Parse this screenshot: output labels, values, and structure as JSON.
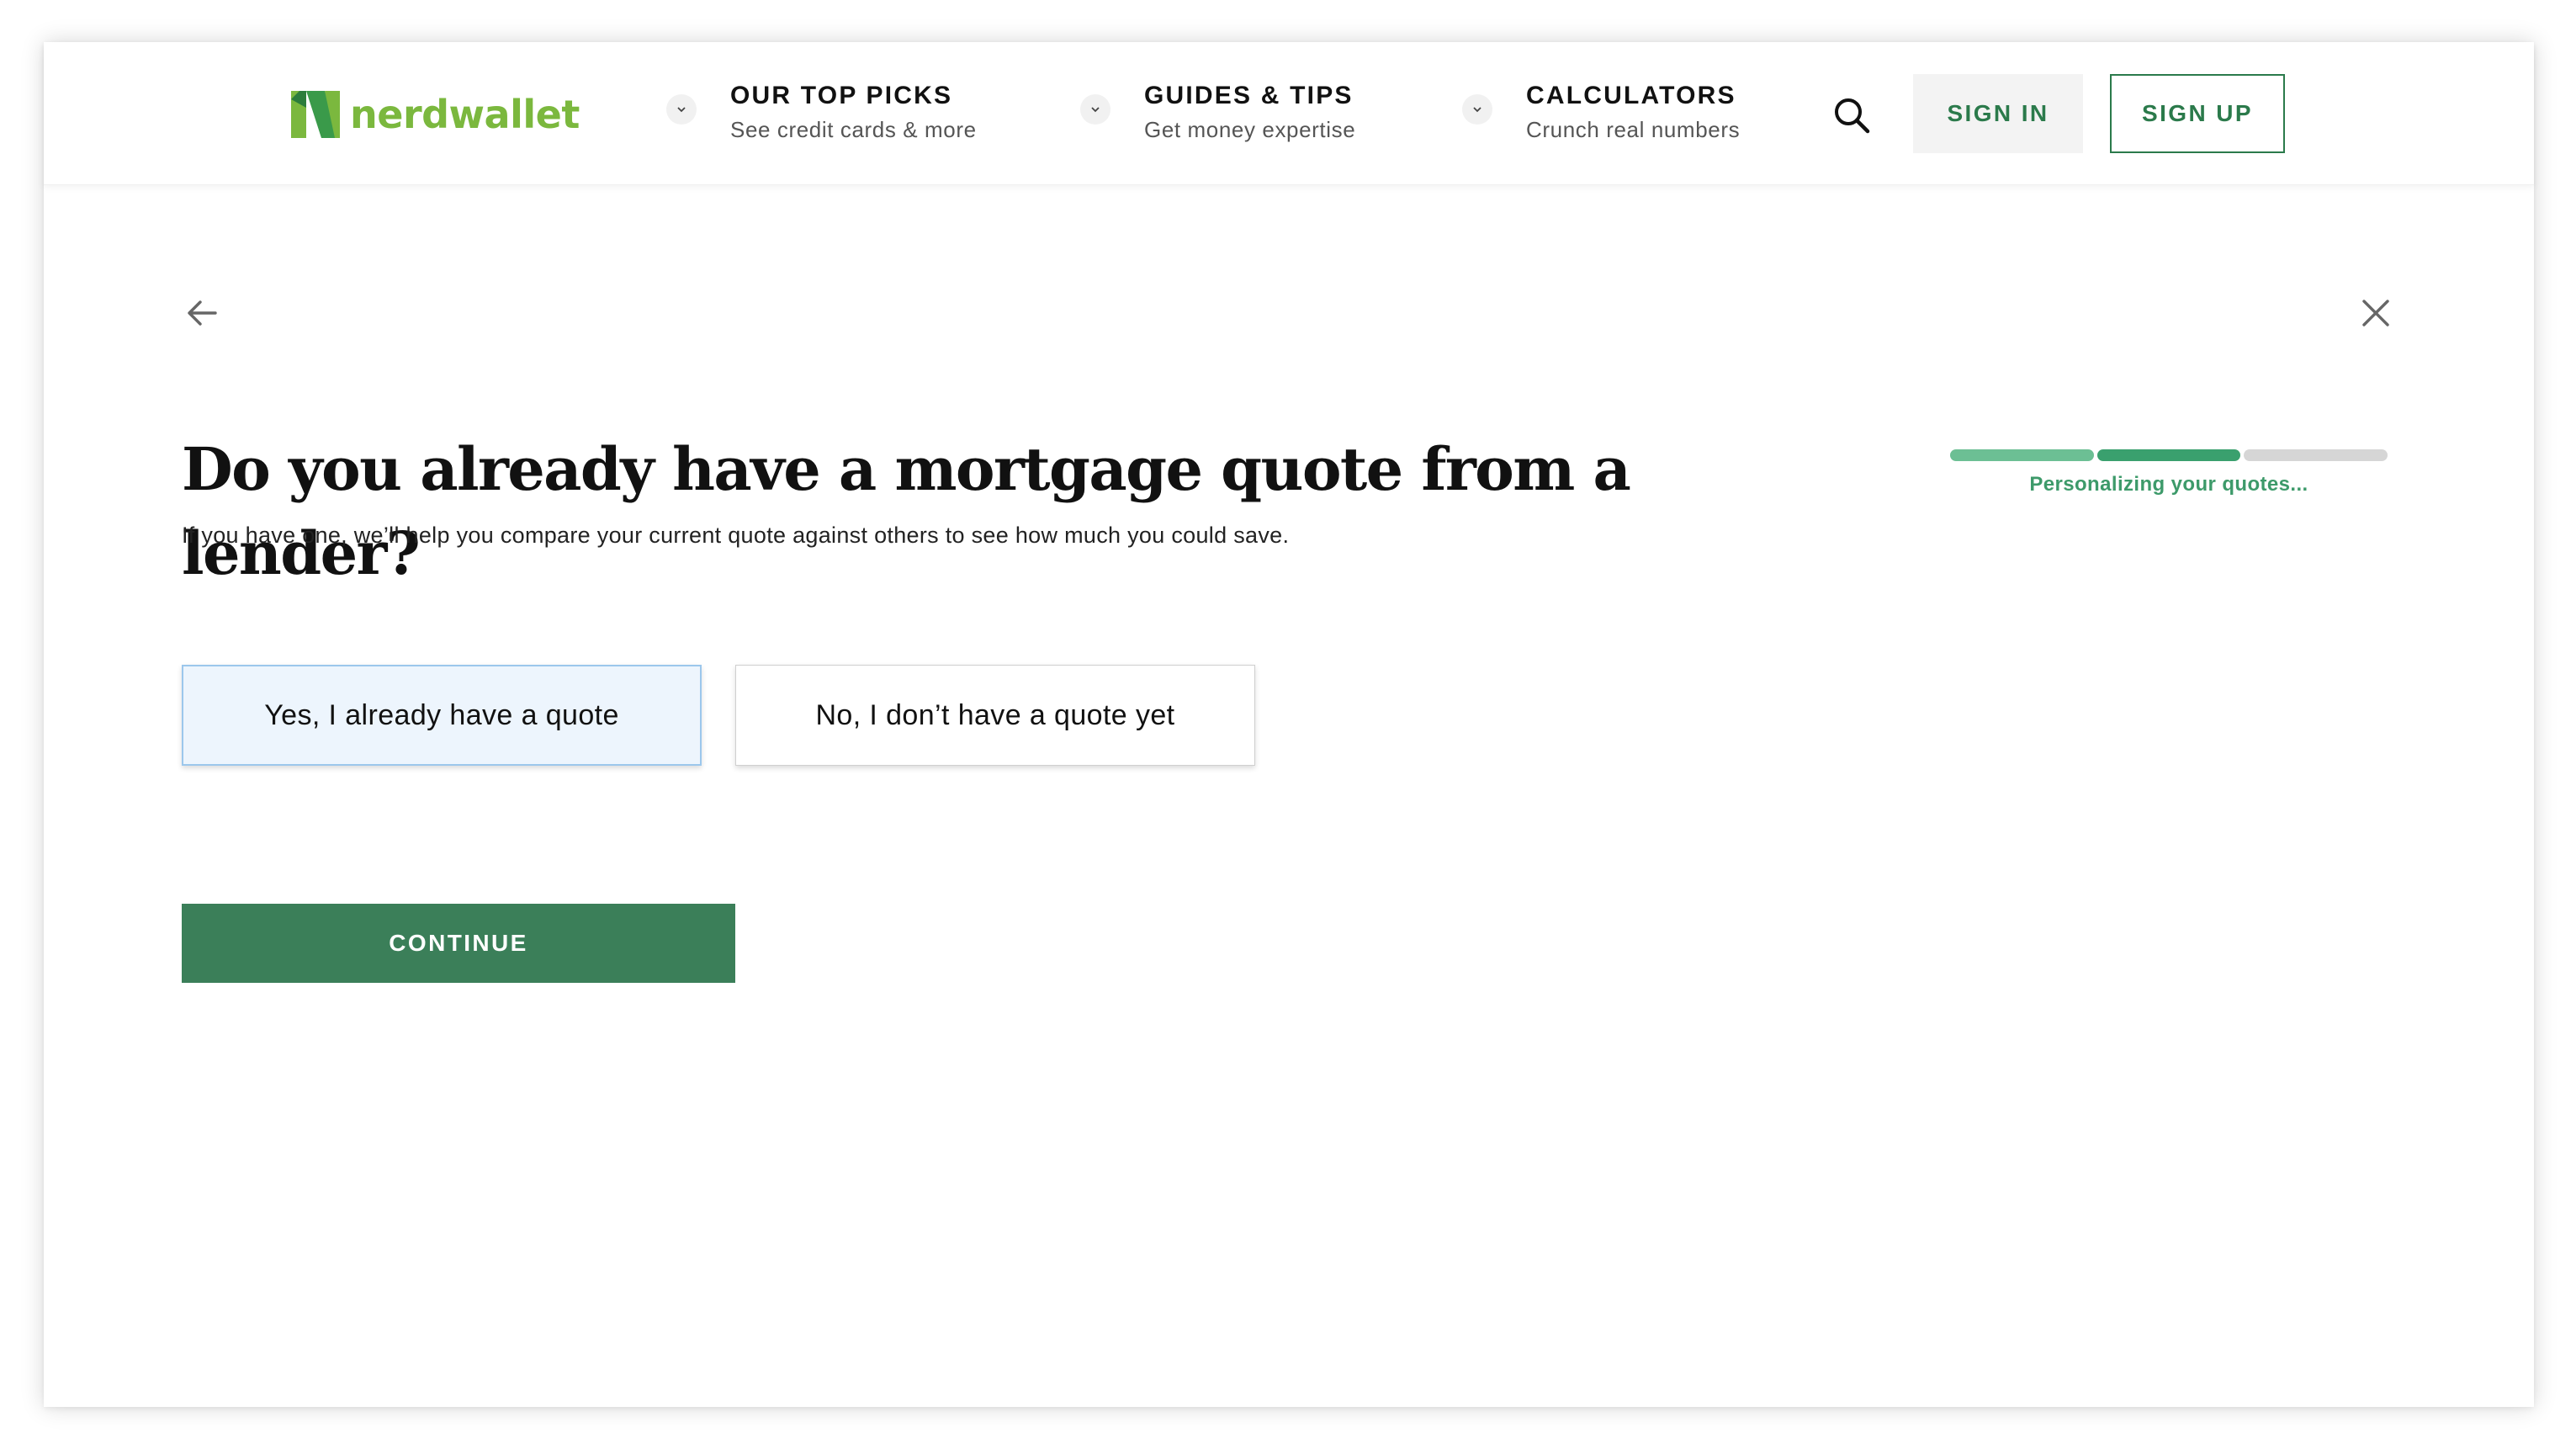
{
  "header": {
    "logo_text": "nerdwallet",
    "nav": [
      {
        "title": "OUR TOP PICKS",
        "subtitle": "See credit cards & more"
      },
      {
        "title": "GUIDES & TIPS",
        "subtitle": "Get money expertise"
      },
      {
        "title": "CALCULATORS",
        "subtitle": "Crunch real numbers"
      }
    ],
    "signin_label": "SIGN IN",
    "signup_label": "SIGN UP"
  },
  "question": {
    "title": "Do you already have a mortgage quote from a lender?",
    "subtitle": "If you have one, we’ll help you compare your current quote against others to see how much you could save.",
    "options": [
      {
        "label": "Yes, I already have a quote",
        "selected": true
      },
      {
        "label": "No, I don’t have a quote yet",
        "selected": false
      }
    ],
    "continue_label": "CONTINUE"
  },
  "progress": {
    "label": "Personalizing your quotes...",
    "segments_total": 3,
    "segments_done": 2
  },
  "icons": [
    "nerdwallet-logo-icon",
    "chevron-down-icon",
    "search-icon",
    "back-arrow-icon",
    "close-icon"
  ],
  "colors": {
    "brand_green": "#2b7a4b",
    "logo_green": "#7bb83e",
    "continue_bg": "#3b7f59",
    "selected_bg": "#edf5fd",
    "selected_border": "#9cc7ec",
    "progress_done": "#6cbf94",
    "progress_label": "#3d9a6a"
  }
}
